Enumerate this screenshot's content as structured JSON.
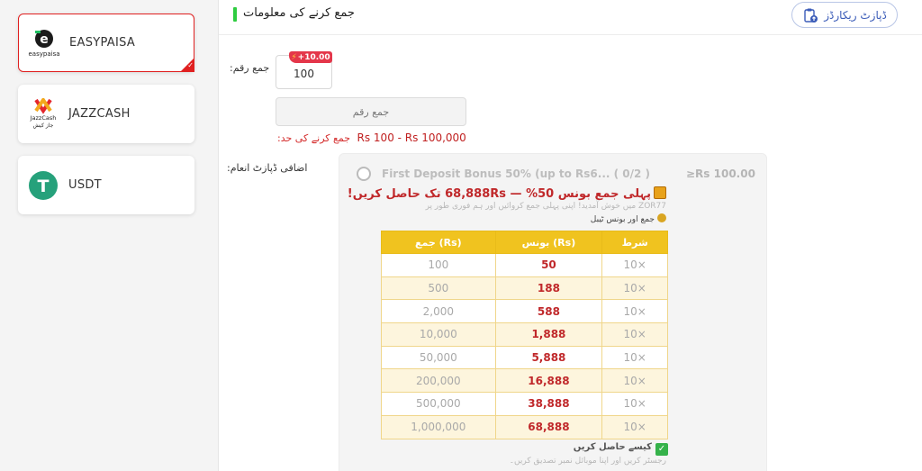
{
  "sidebar": {
    "items": [
      {
        "label": "EASYPAISA",
        "logo_text": "easypaisa",
        "active": true
      },
      {
        "label": "JAZZCASH",
        "logo_text": "JazzCash",
        "logo_sub": "جاز کیش",
        "active": false
      },
      {
        "label": "USDT",
        "logo_text": "T",
        "active": false
      }
    ],
    "active_check": "✓"
  },
  "header": {
    "title": "جمع کرنے کی معلومات",
    "records_button": "ڈپازٹ ریکارڈز"
  },
  "form": {
    "amount_label": ":جمع رقم",
    "chip_value": "100",
    "chip_badge": "+10.00",
    "input_placeholder": "جمع رقم",
    "limit_label": ":جمع کرنے کی حد",
    "limit_value": "Rs  100  -  Rs  100,000",
    "bonus_label": ":اضافی ڈپازٹ انعام"
  },
  "bonus": {
    "title": "First Deposit Bonus 50% (up to Rs6...  ( 0/2 )",
    "min": "≥Rs  100.00",
    "promo": "پہلی جمع بونس 50% — 68,888Rs تک حاصل کریں!",
    "sub_text": "ZOR77 میں خوش آمدید! اپنی پہلی جمع کروائیں اور ہم فوری طور پر",
    "sub_text2": "جمع اور بونس ٹیبل",
    "table": {
      "headers": [
        "جمع (Rs)",
        "بونس (Rs)",
        "شرط"
      ],
      "rows": [
        {
          "deposit": "100",
          "bonus": "50",
          "mult": "10×"
        },
        {
          "deposit": "500",
          "bonus": "188",
          "mult": "10×"
        },
        {
          "deposit": "2,000",
          "bonus": "588",
          "mult": "10×"
        },
        {
          "deposit": "10,000",
          "bonus": "1,888",
          "mult": "10×"
        },
        {
          "deposit": "50,000",
          "bonus": "5,888",
          "mult": "10×"
        },
        {
          "deposit": "200,000",
          "bonus": "16,888",
          "mult": "10×"
        },
        {
          "deposit": "500,000",
          "bonus": "38,888",
          "mult": "10×"
        },
        {
          "deposit": "1,000,000",
          "bonus": "68,888",
          "mult": "10×"
        }
      ]
    },
    "how_title": "کیسے حاصل کریں",
    "how_check": "✓",
    "how_desc": "رجسٹر کریں اور اپنا موبائل نمبر تصدیق کریں۔"
  },
  "colors": {
    "active_border": "#e02020",
    "accent_green": "#2ecc40",
    "table_header": "#f0c31f",
    "bonus_red": "#c0282a"
  }
}
